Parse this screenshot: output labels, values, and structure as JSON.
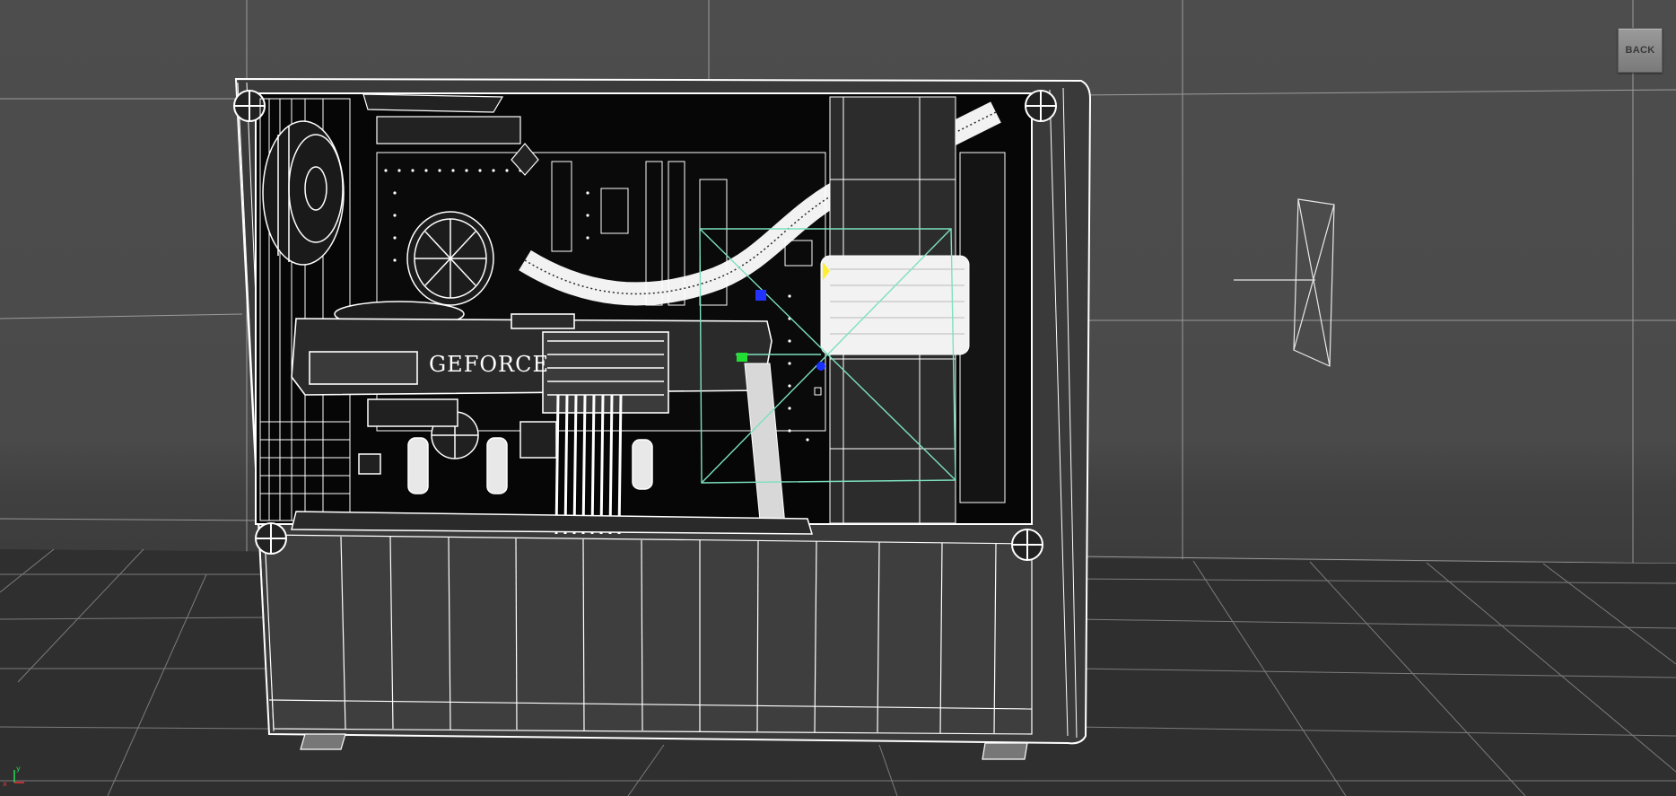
{
  "app": {
    "view": "3D viewport - wireframe"
  },
  "toolbar": {
    "back_label": "BACK"
  },
  "model": {
    "gpu_brand_text": "GEFORCE"
  },
  "gizmo": {
    "x_label": "x",
    "y_label": "y"
  },
  "colors": {
    "background": "#4a4a4a",
    "floor": "#2e2e2e",
    "wire": "#ffffff",
    "selection": "#7de0c0",
    "handle_blue": "#2233ff",
    "handle_green": "#22dd33",
    "handle_yellow": "#ffee33"
  }
}
